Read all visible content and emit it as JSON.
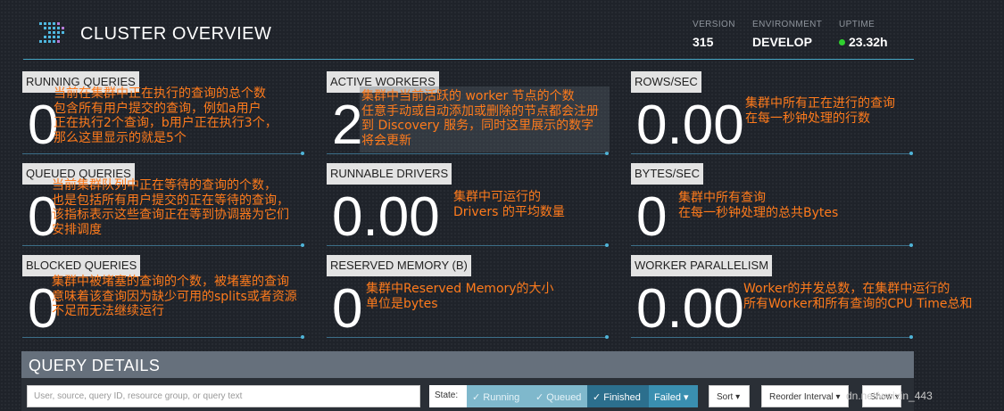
{
  "header": {
    "title": "CLUSTER OVERVIEW",
    "version_label": "VERSION",
    "version_value": "315",
    "environment_label": "ENVIRONMENT",
    "environment_value": "DEVELOP",
    "uptime_label": "UPTIME",
    "uptime_value": "23.32h"
  },
  "tiles": {
    "running_queries": {
      "label": "RUNNING QUERIES",
      "value": "0"
    },
    "active_workers": {
      "label": "ACTIVE WORKERS",
      "value": "2"
    },
    "rows_sec": {
      "label": "ROWS/SEC",
      "value": "0.00"
    },
    "queued_queries": {
      "label": "QUEUED QUERIES",
      "value": "0"
    },
    "runnable_drivers": {
      "label": "RUNNABLE DRIVERS",
      "value": "0.00"
    },
    "bytes_sec": {
      "label": "BYTES/SEC",
      "value": "0"
    },
    "blocked_queries": {
      "label": "BLOCKED QUERIES",
      "value": "0"
    },
    "reserved_memory": {
      "label": "RESERVED MEMORY (B)",
      "value": "0"
    },
    "worker_parallelism": {
      "label": "WORKER PARALLELISM",
      "value": "0.00"
    }
  },
  "annotations": {
    "running_queries": "当前在集群中正在执行的查询的总个数\n包含所有用户提交的查询，例如a用户\n正在执行2个查询，b用户正在执行3个，\n那么这里显示的就是5个",
    "active_workers": "集群中当前活跃的 worker 节点的个数\n任意手动或自动添加或删除的节点都会注册\n到 Discovery 服务，同时这里展示的数字\n将会更新",
    "rows_sec": "集群中所有正在进行的查询\n在每一秒钟处理的行数",
    "queued_queries": "当前集群队列中正在等待的查询的个数，\n也是包括所有用户提交的正在等待的查询，\n该指标表示这些查询正在等到协调器为它们\n安排调度",
    "runnable_drivers": "集群中可运行的\nDrivers 的平均数量",
    "bytes_sec": "集群中所有查询\n在每一秒钟处理的总共Bytes",
    "blocked_queries": "集群中被堵塞的查询的个数，被堵塞的查询\n意味着该查询因为缺少可用的splits或者资源\n不足而无法继续运行",
    "reserved_memory": "集群中Reserved Memory的大小\n单位是bytes",
    "worker_parallelism": "Worker的并发总数，在集群中运行的\n所有Worker和所有查询的CPU Time总和"
  },
  "query_details": {
    "title": "QUERY DETAILS",
    "search_placeholder": "User, source, query ID, resource group, or query text",
    "state_label": "State:",
    "filters": {
      "running": "Running",
      "queued": "Queued",
      "finished": "Finished",
      "failed": "Failed"
    },
    "sort_label": "Sort",
    "reorder_label": "Reorder Interval",
    "show_label": "Show"
  },
  "watermark": "dn.net/weixin_443",
  "colors": {
    "background": "#1f232a",
    "accent": "#46a6c4",
    "annotation": "#ff7b1c",
    "uptime_dot": "#2fd02f"
  }
}
